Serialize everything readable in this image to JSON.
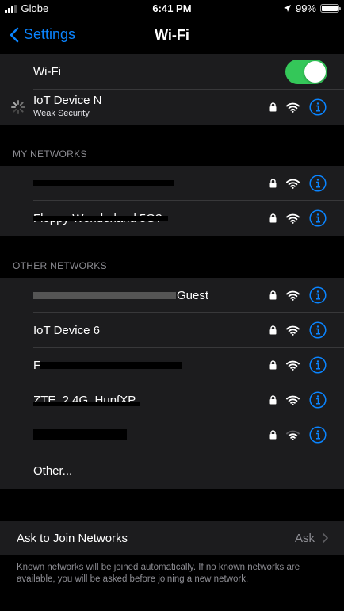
{
  "status": {
    "carrier": "Globe",
    "time": "6:41 PM",
    "battery": "99%"
  },
  "nav": {
    "back_label": "Settings",
    "title": "Wi-Fi"
  },
  "wifi_toggle": {
    "label": "Wi-Fi",
    "on": true
  },
  "connecting": {
    "name": "IoT Device N",
    "subtitle": "Weak Security"
  },
  "my_networks": {
    "header": "MY NETWORKS",
    "items": [
      {
        "name": "",
        "secure": true,
        "signal": "full"
      },
      {
        "name": "Floppy Wonderland 5G?",
        "secure": true,
        "signal": "full"
      }
    ]
  },
  "other_networks": {
    "header": "OTHER NETWORKS",
    "items": [
      {
        "name": "Guest",
        "secure": true,
        "signal": "full"
      },
      {
        "name": "IoT Device 6",
        "secure": true,
        "signal": "full"
      },
      {
        "name": "F",
        "secure": true,
        "signal": "full"
      },
      {
        "name": "ZTE_2.4G_HunfXP",
        "secure": true,
        "signal": "full"
      },
      {
        "name": "",
        "secure": true,
        "signal": "medium"
      }
    ],
    "other_label": "Other..."
  },
  "ask_to_join": {
    "label": "Ask to Join Networks",
    "value": "Ask"
  },
  "footer_note": "Known networks will be joined automatically. If no known networks are available, you will be asked before joining a new network.",
  "colors": {
    "accent": "#0a84ff",
    "toggle_on": "#34c759",
    "cell_bg": "#1c1c1e",
    "secondary_text": "#8d8d93"
  }
}
